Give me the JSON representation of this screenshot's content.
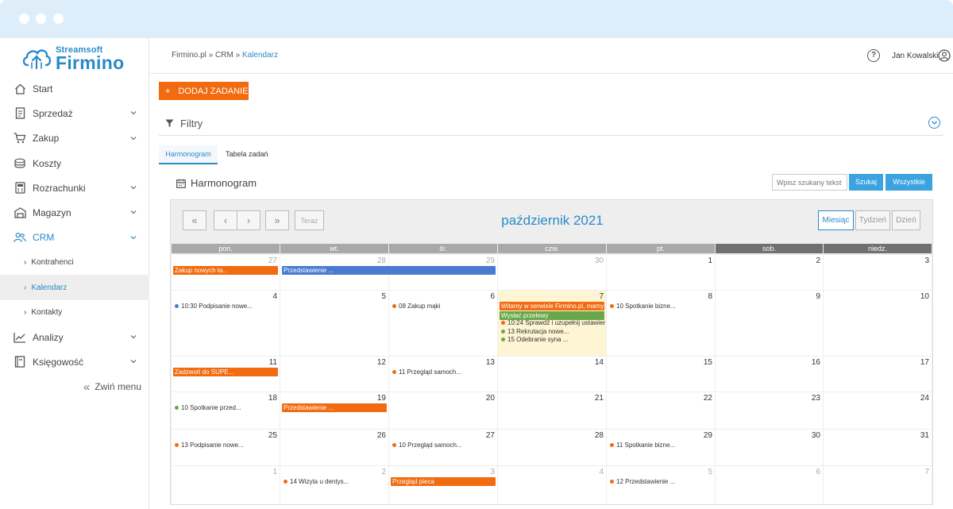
{
  "app": {
    "brand_small": "Streamsoft",
    "brand_big": "Firmino"
  },
  "colors": {
    "accent": "#2a8ac8",
    "primary_button": "#f26b10",
    "search_button": "#3aa3e0",
    "event_orange": "#f26b10",
    "event_blue": "#4a7bd0",
    "event_green": "#68a84a",
    "today_bg": "#fdf5d3"
  },
  "sidebar": {
    "items": [
      {
        "label": "Start",
        "icon": "home-icon",
        "has_chevron": false
      },
      {
        "label": "Sprzedaż",
        "icon": "receipt-icon",
        "has_chevron": true
      },
      {
        "label": "Zakup",
        "icon": "cart-icon",
        "has_chevron": true
      },
      {
        "label": "Koszty",
        "icon": "coins-icon",
        "has_chevron": false
      },
      {
        "label": "Rozrachunki",
        "icon": "calculator-icon",
        "has_chevron": true
      },
      {
        "label": "Magazyn",
        "icon": "warehouse-icon",
        "has_chevron": true
      },
      {
        "label": "CRM",
        "icon": "users-icon",
        "has_chevron": true
      }
    ],
    "crm_sub": [
      {
        "label": "Kontrahenci"
      },
      {
        "label": "Kalendarz"
      },
      {
        "label": "Kontakty"
      }
    ],
    "items_after": [
      {
        "label": "Analizy",
        "icon": "chart-line-icon",
        "has_chevron": true
      },
      {
        "label": "Księgowość",
        "icon": "book-icon",
        "has_chevron": true
      }
    ],
    "collapse_label": "Zwiń menu"
  },
  "header": {
    "crumb1": "Firmino.pl",
    "sep": "»",
    "crumb2": "CRM",
    "crumb3": "Kalendarz",
    "help": "?",
    "user_name": "Jan Kowalski"
  },
  "toolbar": {
    "add_plus": "+",
    "add_label": "DODAJ ZADANIE",
    "filters_label": "Filtry"
  },
  "tabs": [
    {
      "label": "Harmonogram"
    },
    {
      "label": "Tabela zadań"
    }
  ],
  "section": {
    "title": "Harmonogram",
    "search_placeholder": "Wpisz szukany tekst",
    "search_button": "Szukaj",
    "all_button": "Wszystkie"
  },
  "calendar": {
    "nav": {
      "prev_year": "«",
      "prev": "‹",
      "next": "›",
      "next_year": "»",
      "today": "Teraz"
    },
    "title": "październik 2021",
    "views": [
      "Miesiąc",
      "Tydzień",
      "Dzień"
    ],
    "weekdays": [
      "pon.",
      "wt.",
      "śr.",
      "czw.",
      "pt.",
      "sob.",
      "niedz."
    ],
    "weeks": [
      [
        "27",
        "28",
        "29",
        "30",
        "1",
        "2",
        "3"
      ],
      [
        "4",
        "5",
        "6",
        "7",
        "8",
        "9",
        "10"
      ],
      [
        "11",
        "12",
        "13",
        "14",
        "15",
        "16",
        "17"
      ],
      [
        "18",
        "19",
        "20",
        "21",
        "22",
        "23",
        "24"
      ],
      [
        "25",
        "26",
        "27",
        "28",
        "29",
        "30",
        "31"
      ],
      [
        "1",
        "2",
        "3",
        "4",
        "5",
        "6",
        "7"
      ]
    ],
    "bars": [
      {
        "week": 0,
        "day": 0,
        "span": 1,
        "slot": 0,
        "color": "orange",
        "text": "Zakup nowych ta..."
      },
      {
        "week": 0,
        "day": 1,
        "span": 2,
        "slot": 0,
        "color": "blue",
        "text": "Przedstawienie ..."
      },
      {
        "week": 1,
        "day": 3,
        "span": 1,
        "slot": 0,
        "color": "orange",
        "text": "Witamy w serwisie Firmino.pl, mamy"
      },
      {
        "week": 1,
        "day": 3,
        "span": 1,
        "slot": 1,
        "color": "green",
        "text": "Wysłać przelewy"
      },
      {
        "week": 2,
        "day": 0,
        "span": 1,
        "slot": 0,
        "color": "orange",
        "text": "Zadzwoń do SUPE..."
      },
      {
        "week": 3,
        "day": 1,
        "span": 1,
        "slot": 0,
        "color": "orange",
        "text": "Przedstawienie ..."
      },
      {
        "week": 5,
        "day": 2,
        "span": 1,
        "slot": 0,
        "color": "orange",
        "text": "Przegląd pieca"
      }
    ],
    "events": [
      {
        "week": 1,
        "day": 0,
        "slot": 0,
        "dot": "blue",
        "time": "10:30",
        "title": "Podpisanie nowe..."
      },
      {
        "week": 1,
        "day": 2,
        "slot": 0,
        "dot": "orange",
        "time": "08",
        "title": "Zakup mąki"
      },
      {
        "week": 1,
        "day": 3,
        "slot": 2,
        "dot": "orange",
        "time": "10:24",
        "title": "Sprawdź i uzupełnij ustawienia"
      },
      {
        "week": 1,
        "day": 3,
        "slot": 3,
        "dot": "green",
        "time": "13",
        "title": "Rekrutacja nowe..."
      },
      {
        "week": 1,
        "day": 3,
        "slot": 4,
        "dot": "green",
        "time": "15",
        "title": "Odebranie syna ..."
      },
      {
        "week": 1,
        "day": 4,
        "slot": 0,
        "dot": "orange",
        "time": "10",
        "title": "Spotkanie bizne..."
      },
      {
        "week": 2,
        "day": 2,
        "slot": 0,
        "dot": "orange",
        "time": "11",
        "title": "Przegląd samoch..."
      },
      {
        "week": 3,
        "day": 0,
        "slot": 0,
        "dot": "green",
        "time": "10",
        "title": "Spotkanie przed..."
      },
      {
        "week": 4,
        "day": 0,
        "slot": 0,
        "dot": "orange",
        "time": "13",
        "title": "Podpisanie nowe..."
      },
      {
        "week": 4,
        "day": 2,
        "slot": 0,
        "dot": "orange",
        "time": "10",
        "title": "Przegląd samoch..."
      },
      {
        "week": 4,
        "day": 4,
        "slot": 0,
        "dot": "orange",
        "time": "11",
        "title": "Spotkanie bizne..."
      },
      {
        "week": 5,
        "day": 1,
        "slot": 0,
        "dot": "orange",
        "time": "14",
        "title": "Wizyta u dentys..."
      },
      {
        "week": 5,
        "day": 4,
        "slot": 0,
        "dot": "orange",
        "time": "12",
        "title": "Przedstawienie ..."
      }
    ]
  }
}
